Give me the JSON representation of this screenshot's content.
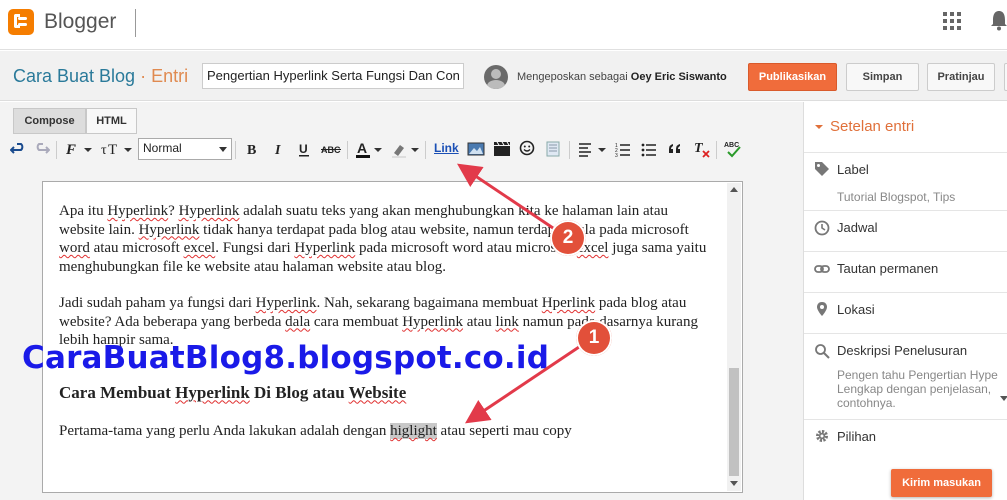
{
  "header": {
    "brand": "Blogger"
  },
  "titlebar": {
    "blog_name": "Cara Buat Blog",
    "separator": " · ",
    "section": "Entri",
    "post_title": "Pengertian Hyperlink Serta Fungsi Dan Con",
    "posting_as_prefix": "Mengeposkan sebagai",
    "user_name": "Oey Eric Siswanto",
    "publish_label": "Publikasikan",
    "save_label": "Simpan",
    "preview_label": "Pratinjau"
  },
  "editor": {
    "tabs": [
      "Compose",
      "HTML"
    ],
    "font_size_value": "Normal",
    "link_label": "Link",
    "paragraphs": {
      "p1": {
        "a": "Apa itu ",
        "b": "Hyperlink",
        "c": "? ",
        "d": "Hyperlink",
        "e": " adalah suatu teks yang akan menghubungkan kita ke halaman lain atau website lain. ",
        "f": "Hyperlink",
        "g": " tidak hanya terdapat pada blog atau website, namun terdapat pula pada microsoft ",
        "h": "word",
        "i": " atau microsoft ",
        "j": "excel",
        "k": ". Fungsi dari ",
        "l": "Hyperlink",
        "m": " pada microsoft word atau microsoft ",
        "n": "excel",
        "o": " juga sama yaitu menghubungkan file ke website atau halaman website atau blog."
      },
      "p2": {
        "a": "Jadi sudah paham ya fungsi dari ",
        "b": "Hyperlink",
        "c": ". Nah, sekarang bagaimana membuat ",
        "d": "Hperlink",
        "e": " pada blog atau website? Ada beberapa yang berbeda ",
        "f": "dala",
        "g": " cara membuat ",
        "h": "Hyperlink",
        "i": " atau ",
        "j": "link",
        "k": " namun pada dasarnya kurang lebih hampir sama."
      },
      "heading": {
        "a": "Cara Membuat ",
        "b": "Hyperlink",
        "c": " Di Blog atau ",
        "d": "Website"
      },
      "p3": {
        "a": "Pertama-tama yang perlu Anda lakukan adalah dengan ",
        "b": "higlight",
        "c": " atau seperti mau copy"
      }
    },
    "watermark": "CaraBuatBlog8.blogspot.co.id",
    "badges": [
      "2",
      "1"
    ]
  },
  "sidebar": {
    "title": "Setelan entri",
    "items": [
      {
        "label": "Label",
        "sub": "Tutorial Blogspot, Tips",
        "icon": "tag-icon"
      },
      {
        "label": "Jadwal",
        "icon": "clock-icon"
      },
      {
        "label": "Tautan permanen",
        "icon": "link-icon"
      },
      {
        "label": "Lokasi",
        "icon": "location-pin-icon"
      },
      {
        "label": "Deskripsi Penelusuran",
        "sub": [
          "Pengen tahu Pengertian Hype",
          "Lengkap dengan penjelasan, ",
          "contohnya."
        ],
        "icon": "search-icon"
      },
      {
        "label": "Pilihan",
        "icon": "gear-icon"
      }
    ],
    "feedback_label": "Kirim masukan"
  },
  "colors": {
    "accent": "#f06c3b",
    "blog_name": "#2a7a9a",
    "watermark": "#1a1ae8",
    "badge": "#e2503a",
    "arrow": "#e23a4a"
  }
}
